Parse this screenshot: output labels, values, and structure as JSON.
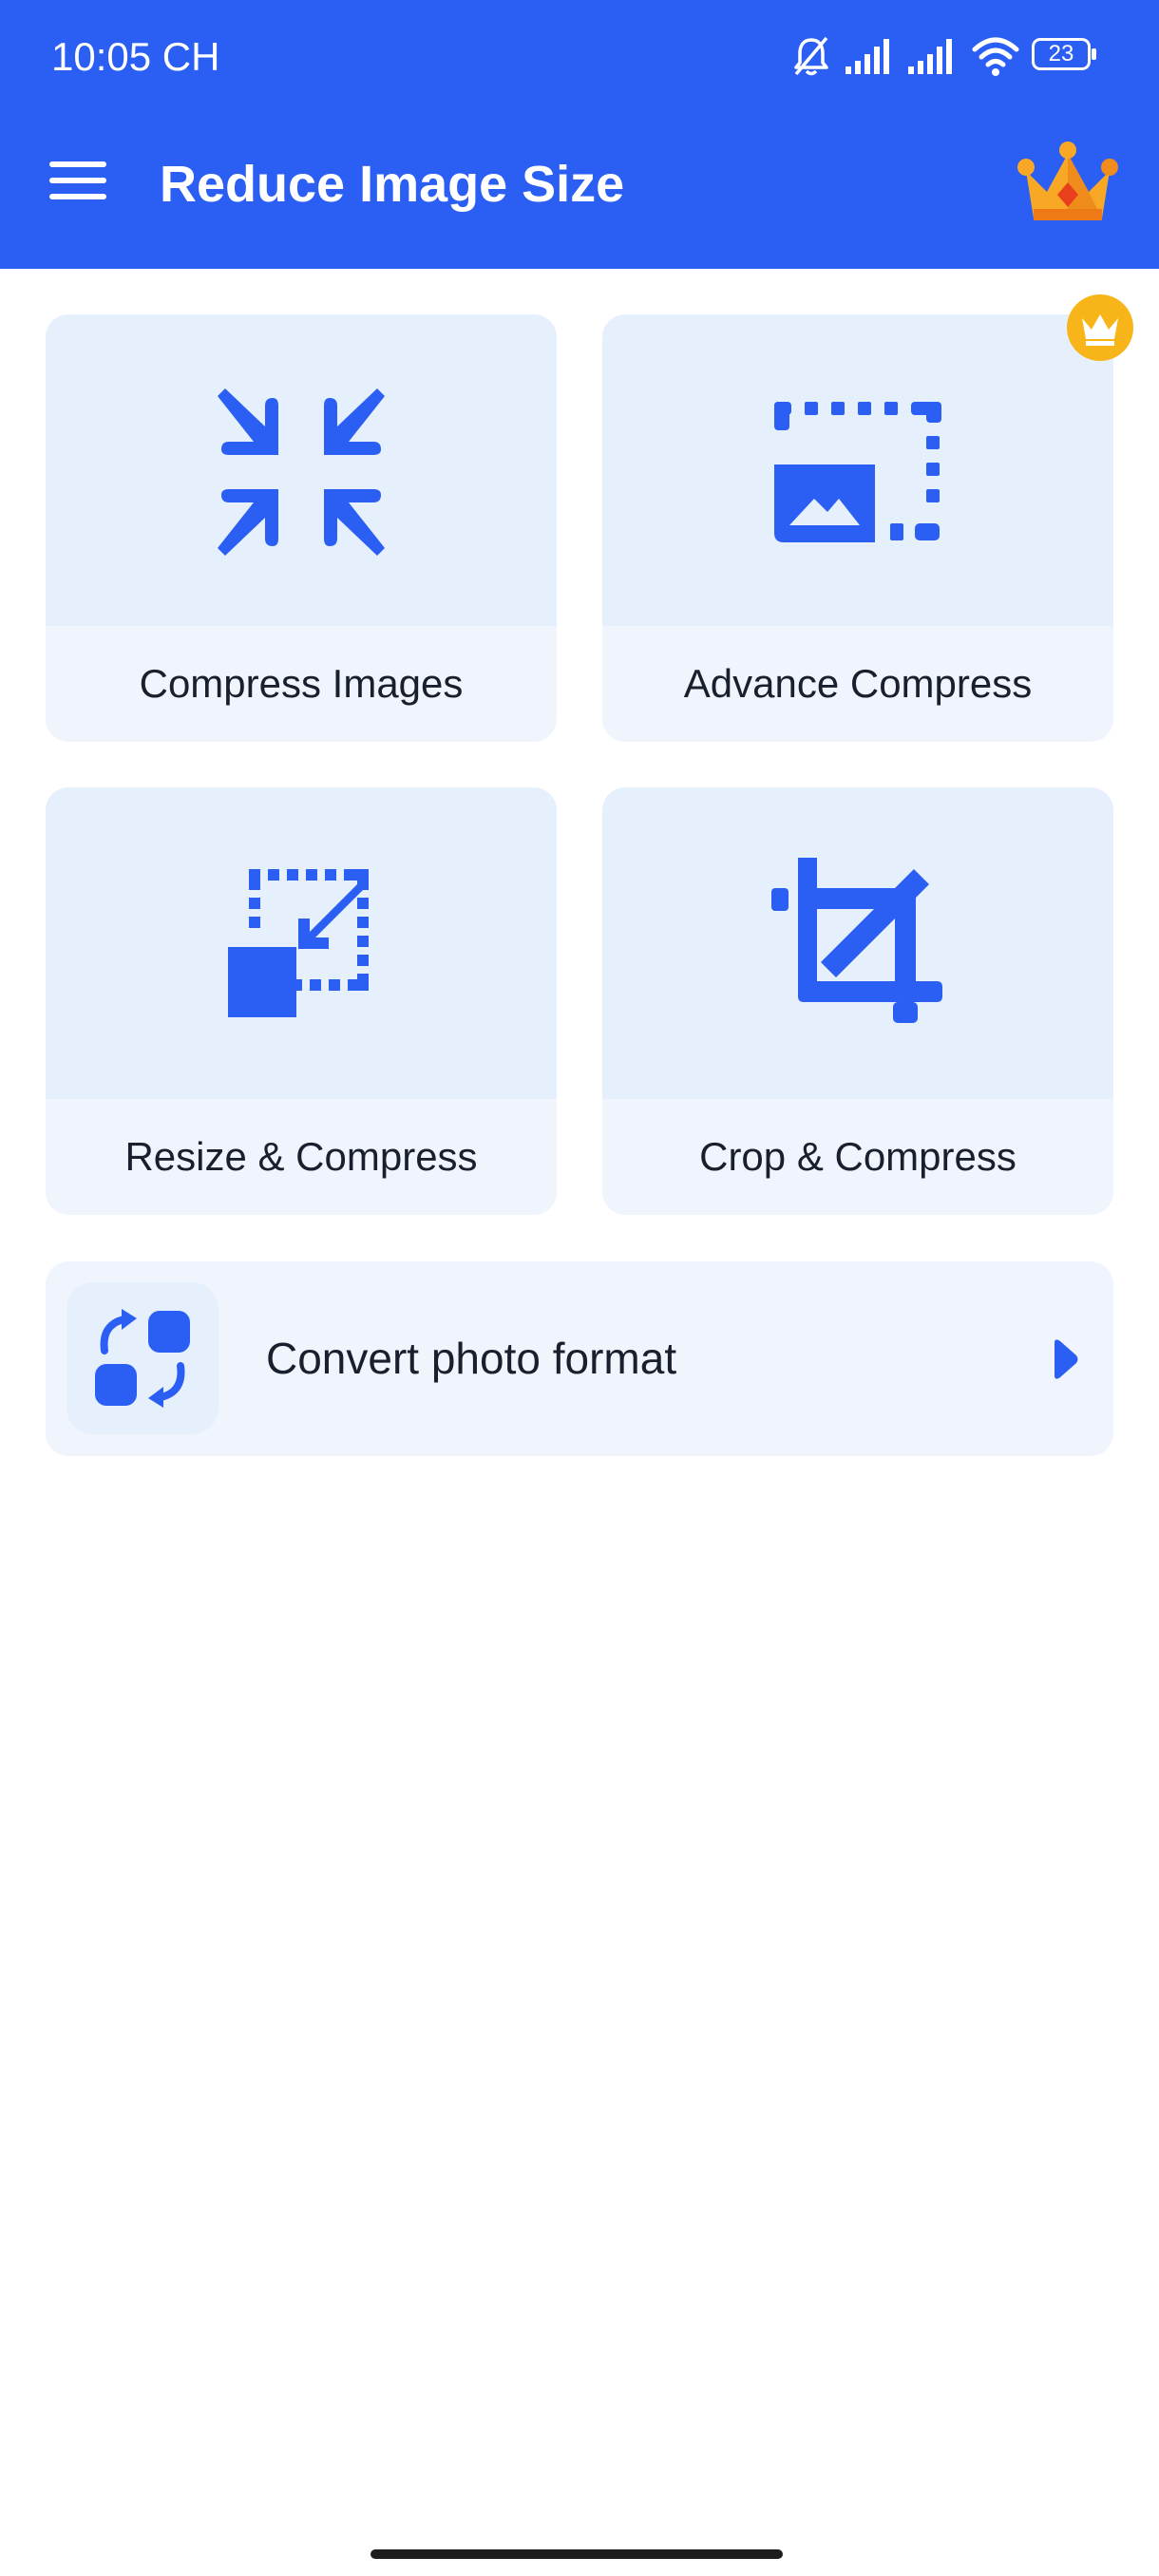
{
  "status_bar": {
    "time": "10:05 CH",
    "battery": "23",
    "icons": [
      "bell-off-icon",
      "signal-icon",
      "signal-icon",
      "wifi-icon",
      "battery-icon"
    ]
  },
  "app_bar": {
    "title": "Reduce Image Size",
    "menu_icon": "hamburger-menu-icon",
    "premium_icon": "crown-icon"
  },
  "tools": [
    {
      "label": "Compress Images",
      "icon": "compress-arrows-icon",
      "premium": false
    },
    {
      "label": "Advance Compress",
      "icon": "dashed-image-icon",
      "premium": true
    },
    {
      "label": "Resize & Compress",
      "icon": "resize-icon",
      "premium": false
    },
    {
      "label": "Crop & Compress",
      "icon": "crop-icon",
      "premium": false
    }
  ],
  "convert": {
    "label": "Convert photo format",
    "icon": "convert-format-icon",
    "arrow_icon": "play-arrow-icon"
  },
  "colors": {
    "primary": "#2b5ff3",
    "card_background": "#f0f5fd",
    "icon_background": "#e6f0fc",
    "badge": "#f7b519",
    "crown": "#f59e1b"
  }
}
